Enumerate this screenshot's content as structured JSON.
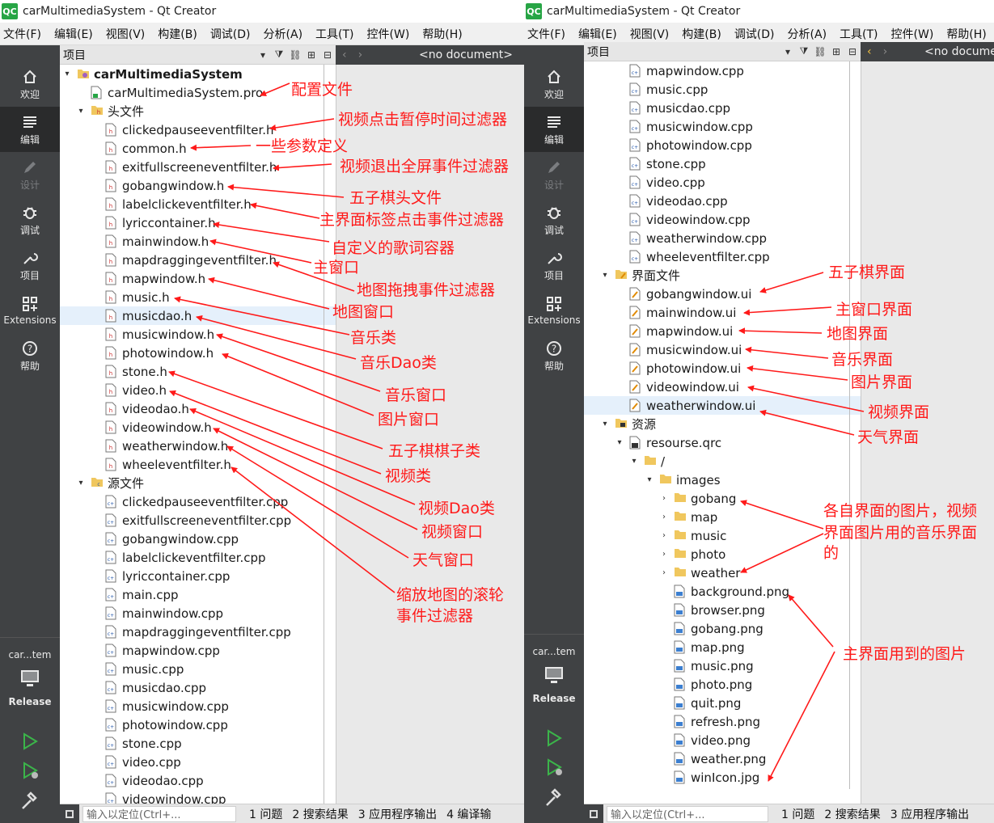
{
  "window_title": "carMultimediaSystem - Qt Creator",
  "app_logo": "QC",
  "menu": [
    "文件(F)",
    "编辑(E)",
    "视图(V)",
    "构建(B)",
    "调试(D)",
    "分析(A)",
    "工具(T)",
    "控件(W)",
    "帮助(H)"
  ],
  "modes": [
    {
      "label": "欢迎",
      "icon": "home-icon"
    },
    {
      "label": "编辑",
      "icon": "edit-icon"
    },
    {
      "label": "设计",
      "icon": "design-icon"
    },
    {
      "label": "调试",
      "icon": "bug-icon"
    },
    {
      "label": "项目",
      "icon": "wrench-icon"
    },
    {
      "label": "Extensions",
      "icon": "extensions-icon"
    },
    {
      "label": "帮助",
      "icon": "help-icon"
    }
  ],
  "kit": {
    "name": "car...tem",
    "build": "Release"
  },
  "navigator": {
    "title": "项目",
    "document": "<no document>"
  },
  "statusbar": {
    "locator_placeholder": "输入以定位(Ctrl+...",
    "tabs_left": [
      "1 问题",
      "2 搜索结果",
      "3 应用程序输出",
      "4 编译输"
    ],
    "tabs_right": [
      "1 问题",
      "2 搜索结果",
      "3 应用程序输出"
    ]
  },
  "left_tree": [
    {
      "label": "carMultimediaSystem",
      "type": "project",
      "indent": 0,
      "arrow": "down",
      "bold": true
    },
    {
      "label": "carMultimediaSystem.pro",
      "type": "pro",
      "indent": 1
    },
    {
      "label": "头文件",
      "type": "folder-h",
      "indent": 1,
      "arrow": "down"
    },
    {
      "label": "clickedpauseeventfilter.h",
      "type": "h",
      "indent": 2
    },
    {
      "label": "common.h",
      "type": "h",
      "indent": 2
    },
    {
      "label": "exitfullscreeneventfilter.h",
      "type": "h",
      "indent": 2
    },
    {
      "label": "gobangwindow.h",
      "type": "h",
      "indent": 2
    },
    {
      "label": "labelclickeventfilter.h",
      "type": "h",
      "indent": 2
    },
    {
      "label": "lyriccontainer.h",
      "type": "h",
      "indent": 2
    },
    {
      "label": "mainwindow.h",
      "type": "h",
      "indent": 2
    },
    {
      "label": "mapdraggingeventfilter.h",
      "type": "h",
      "indent": 2
    },
    {
      "label": "mapwindow.h",
      "type": "h",
      "indent": 2
    },
    {
      "label": "music.h",
      "type": "h",
      "indent": 2
    },
    {
      "label": "musicdao.h",
      "type": "h",
      "indent": 2,
      "selected": true
    },
    {
      "label": "musicwindow.h",
      "type": "h",
      "indent": 2
    },
    {
      "label": "photowindow.h",
      "type": "h",
      "indent": 2
    },
    {
      "label": "stone.h",
      "type": "h",
      "indent": 2
    },
    {
      "label": "video.h",
      "type": "h",
      "indent": 2
    },
    {
      "label": "videodao.h",
      "type": "h",
      "indent": 2
    },
    {
      "label": "videowindow.h",
      "type": "h",
      "indent": 2
    },
    {
      "label": "weatherwindow.h",
      "type": "h",
      "indent": 2
    },
    {
      "label": "wheeleventfilter.h",
      "type": "h",
      "indent": 2
    },
    {
      "label": "源文件",
      "type": "folder-c",
      "indent": 1,
      "arrow": "down"
    },
    {
      "label": "clickedpauseeventfilter.cpp",
      "type": "cpp",
      "indent": 2
    },
    {
      "label": "exitfullscreeneventfilter.cpp",
      "type": "cpp",
      "indent": 2
    },
    {
      "label": "gobangwindow.cpp",
      "type": "cpp",
      "indent": 2
    },
    {
      "label": "labelclickeventfilter.cpp",
      "type": "cpp",
      "indent": 2
    },
    {
      "label": "lyriccontainer.cpp",
      "type": "cpp",
      "indent": 2
    },
    {
      "label": "main.cpp",
      "type": "cpp",
      "indent": 2
    },
    {
      "label": "mainwindow.cpp",
      "type": "cpp",
      "indent": 2
    },
    {
      "label": "mapdraggingeventfilter.cpp",
      "type": "cpp",
      "indent": 2
    },
    {
      "label": "mapwindow.cpp",
      "type": "cpp",
      "indent": 2
    },
    {
      "label": "music.cpp",
      "type": "cpp",
      "indent": 2
    },
    {
      "label": "musicdao.cpp",
      "type": "cpp",
      "indent": 2
    },
    {
      "label": "musicwindow.cpp",
      "type": "cpp",
      "indent": 2
    },
    {
      "label": "photowindow.cpp",
      "type": "cpp",
      "indent": 2
    },
    {
      "label": "stone.cpp",
      "type": "cpp",
      "indent": 2
    },
    {
      "label": "video.cpp",
      "type": "cpp",
      "indent": 2
    },
    {
      "label": "videodao.cpp",
      "type": "cpp",
      "indent": 2
    },
    {
      "label": "videowindow.cpp",
      "type": "cpp",
      "indent": 2
    }
  ],
  "right_tree": [
    {
      "label": "mapwindow.cpp",
      "type": "cpp",
      "indent": 2
    },
    {
      "label": "music.cpp",
      "type": "cpp",
      "indent": 2
    },
    {
      "label": "musicdao.cpp",
      "type": "cpp",
      "indent": 2
    },
    {
      "label": "musicwindow.cpp",
      "type": "cpp",
      "indent": 2
    },
    {
      "label": "photowindow.cpp",
      "type": "cpp",
      "indent": 2
    },
    {
      "label": "stone.cpp",
      "type": "cpp",
      "indent": 2
    },
    {
      "label": "video.cpp",
      "type": "cpp",
      "indent": 2
    },
    {
      "label": "videodao.cpp",
      "type": "cpp",
      "indent": 2
    },
    {
      "label": "videowindow.cpp",
      "type": "cpp",
      "indent": 2
    },
    {
      "label": "weatherwindow.cpp",
      "type": "cpp",
      "indent": 2
    },
    {
      "label": "wheeleventfilter.cpp",
      "type": "cpp",
      "indent": 2
    },
    {
      "label": "界面文件",
      "type": "folder-ui",
      "indent": 1,
      "arrow": "down"
    },
    {
      "label": "gobangwindow.ui",
      "type": "ui",
      "indent": 2
    },
    {
      "label": "mainwindow.ui",
      "type": "ui",
      "indent": 2
    },
    {
      "label": "mapwindow.ui",
      "type": "ui",
      "indent": 2
    },
    {
      "label": "musicwindow.ui",
      "type": "ui",
      "indent": 2
    },
    {
      "label": "photowindow.ui",
      "type": "ui",
      "indent": 2
    },
    {
      "label": "videowindow.ui",
      "type": "ui",
      "indent": 2
    },
    {
      "label": "weatherwindow.ui",
      "type": "ui",
      "indent": 2,
      "selected": true
    },
    {
      "label": "资源",
      "type": "folder-res",
      "indent": 1,
      "arrow": "down"
    },
    {
      "label": "resourse.qrc",
      "type": "qrc",
      "indent": 2,
      "arrow": "down"
    },
    {
      "label": "/",
      "type": "folder",
      "indent": 3,
      "arrow": "down"
    },
    {
      "label": "images",
      "type": "folder",
      "indent": 4,
      "arrow": "down"
    },
    {
      "label": "gobang",
      "type": "folder",
      "indent": 5,
      "arrow": "right"
    },
    {
      "label": "map",
      "type": "folder",
      "indent": 5,
      "arrow": "right"
    },
    {
      "label": "music",
      "type": "folder",
      "indent": 5,
      "arrow": "right"
    },
    {
      "label": "photo",
      "type": "folder",
      "indent": 5,
      "arrow": "right"
    },
    {
      "label": "weather",
      "type": "folder",
      "indent": 5,
      "arrow": "right"
    },
    {
      "label": "background.png",
      "type": "png",
      "indent": 5
    },
    {
      "label": "browser.png",
      "type": "png",
      "indent": 5
    },
    {
      "label": "gobang.png",
      "type": "png",
      "indent": 5
    },
    {
      "label": "map.png",
      "type": "png",
      "indent": 5
    },
    {
      "label": "music.png",
      "type": "png",
      "indent": 5
    },
    {
      "label": "photo.png",
      "type": "png",
      "indent": 5
    },
    {
      "label": "quit.png",
      "type": "png",
      "indent": 5
    },
    {
      "label": "refresh.png",
      "type": "png",
      "indent": 5
    },
    {
      "label": "video.png",
      "type": "png",
      "indent": 5
    },
    {
      "label": "weather.png",
      "type": "png",
      "indent": 5
    },
    {
      "label": "winIcon.jpg",
      "type": "png",
      "indent": 5
    }
  ],
  "annotations": {
    "pro": "配置文件",
    "clickedpause": "视频点击暂停时间过滤器",
    "common": "一些参数定义",
    "exitfull": "视频退出全屏事件过滤器",
    "gobang_h": "五子棋头文件",
    "labelclick": "主界面标签点击事件过滤器",
    "lyric": "自定义的歌词容器",
    "mainwindow_h": "主窗口",
    "mapdrag": "地图拖拽事件过滤器",
    "mapwindow_h": "地图窗口",
    "music_h": "音乐类",
    "musicdao_h": "音乐Dao类",
    "musicwindow_h": "音乐窗口",
    "photowindow_h": "图片窗口",
    "stone_h": "五子棋棋子类",
    "video_h": "视频类",
    "videodao_h": "视频Dao类",
    "videowindow_h": "视频窗口",
    "weather_h": "天气窗口",
    "wheel_1": "缩放地图的滚轮",
    "wheel_2": "事件过滤器",
    "gobang_ui": "五子棋界面",
    "main_ui": "主窗口界面",
    "map_ui": "地图界面",
    "music_ui": "音乐界面",
    "photo_ui": "图片界面",
    "video_ui": "视频界面",
    "weather_ui": "天气界面",
    "images_1": "各自界面的图片，视频",
    "images_2": "界面图片用的音乐界面",
    "images_3": "的",
    "main_imgs": "主界面用到的图片"
  },
  "colors": {
    "annotation": "#ff1a1a",
    "sidebar": "#404244",
    "sidebar_active": "#2a2b2c",
    "selection": "#e5f0fb",
    "logo": "#27a545",
    "run": "#3bb54a",
    "folder": "#f0c75e"
  }
}
